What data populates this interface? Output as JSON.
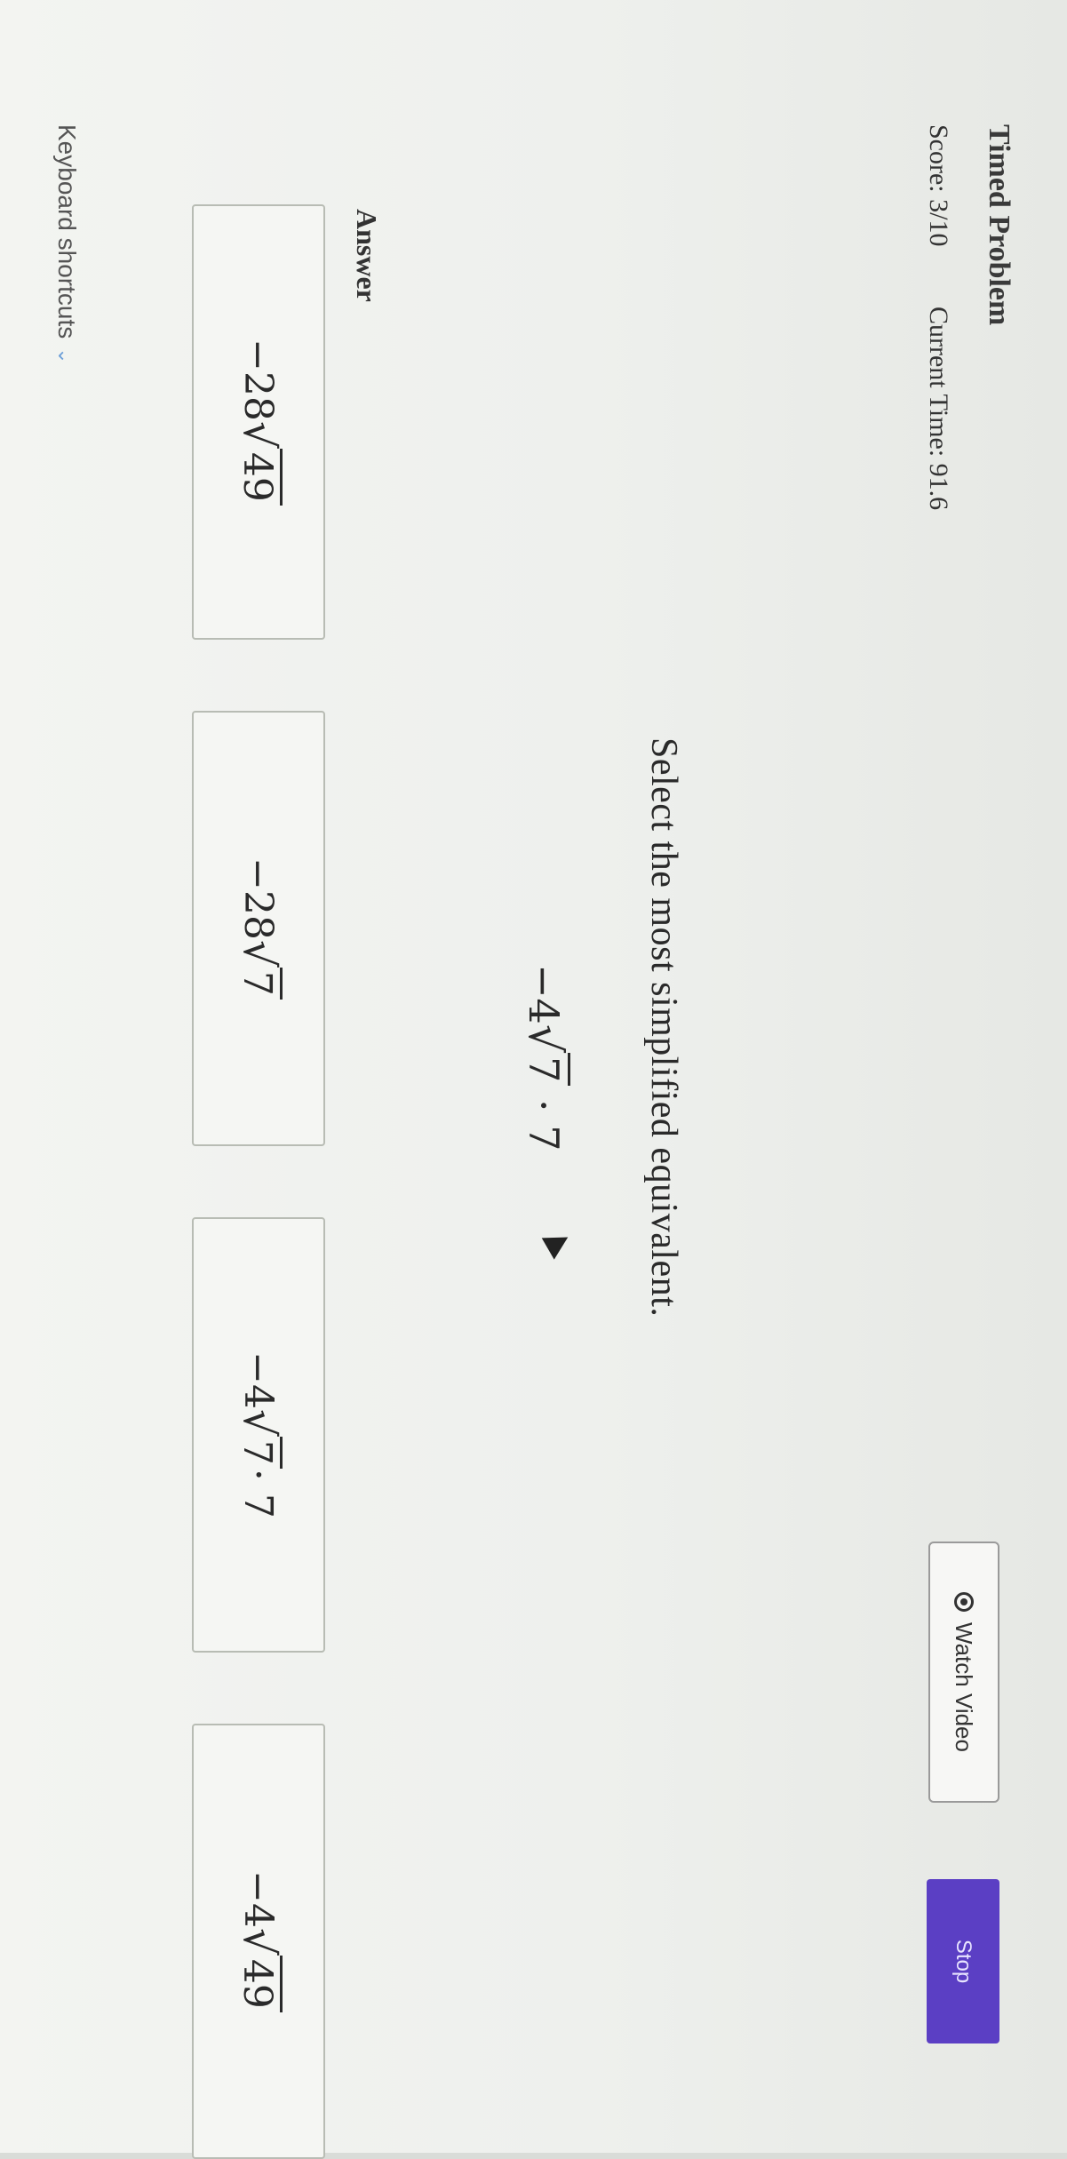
{
  "header": {
    "title": "Timed Problem",
    "score": "Score: 3/10",
    "current_time": "Current Time: 91.6"
  },
  "toolbar": {
    "watch_video_label": "Watch Video",
    "stop_label": "Stop"
  },
  "question": {
    "prompt": "Select the most simplified equivalent.",
    "expression": {
      "prefix": "−4",
      "radicand": "7",
      "suffix": " · 7"
    }
  },
  "answer": {
    "label": "Answer",
    "choices": [
      {
        "prefix": "−28",
        "radicand": "49",
        "suffix": ""
      },
      {
        "prefix": "−28",
        "radicand": "7",
        "suffix": ""
      },
      {
        "prefix": "−4",
        "radicand": "7",
        "suffix": " · 7"
      },
      {
        "prefix": "−4",
        "radicand": "49",
        "suffix": ""
      }
    ]
  },
  "footer": {
    "shortcuts_label": "Keyboard shortcuts",
    "chevron_icon": "chevron-down-icon"
  },
  "colors": {
    "accent": "#5b3fc4",
    "chevron": "#6ea0d8"
  }
}
